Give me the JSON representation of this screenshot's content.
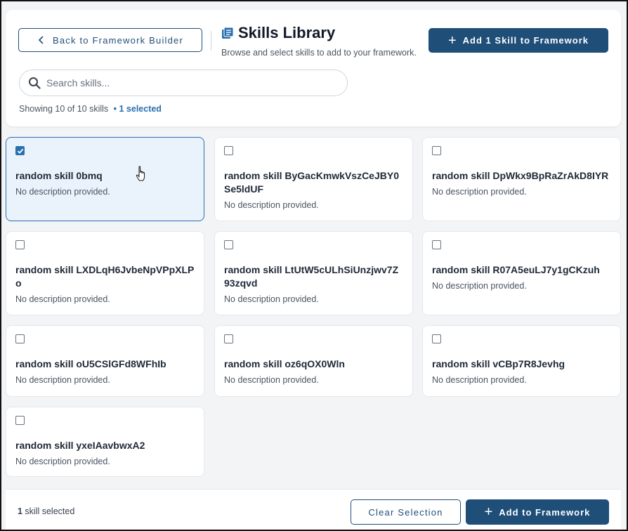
{
  "header": {
    "back_label": "Back to Framework Builder",
    "title": "Skills Library",
    "subtitle": "Browse and select skills to add to your framework.",
    "add_top_label": "Add 1 Skill to Framework"
  },
  "search": {
    "placeholder": "Search skills...",
    "value": ""
  },
  "status": {
    "showing": "Showing 10 of 10 skills",
    "selected": "• 1 selected"
  },
  "skills": [
    {
      "name": "random skill 0bmq",
      "desc": "No description provided.",
      "checked": true
    },
    {
      "name": "random skill ByGacKmwkVszCeJBY0Se5ldUF",
      "desc": "No description provided.",
      "checked": false
    },
    {
      "name": "random skill DpWkx9BpRaZrAkD8IYR",
      "desc": "No description provided.",
      "checked": false
    },
    {
      "name": "random skill LXDLqH6JvbeNpVPpXLPo",
      "desc": "No description provided.",
      "checked": false
    },
    {
      "name": "random skill LtUtW5cULhSiUnzjwv7Z93zqvd",
      "desc": "No description provided.",
      "checked": false
    },
    {
      "name": "random skill R07A5euLJ7y1gCKzuh",
      "desc": "No description provided.",
      "checked": false
    },
    {
      "name": "random skill oU5CSlGFd8WFhIb",
      "desc": "No description provided.",
      "checked": false
    },
    {
      "name": "random skill oz6qOX0Wln",
      "desc": "No description provided.",
      "checked": false
    },
    {
      "name": "random skill vCBp7R8Jevhg",
      "desc": "No description provided.",
      "checked": false
    },
    {
      "name": "random skill yxeIAavbwxA2",
      "desc": "No description provided.",
      "checked": false
    }
  ],
  "footer": {
    "count": "1",
    "count_suffix": " skill selected",
    "clear_label": "Clear Selection",
    "add_label": "Add to Framework"
  },
  "colors": {
    "primary": "#1f4e79",
    "accent": "#2a6fb0",
    "selected_bg": "#eaf3fc"
  }
}
